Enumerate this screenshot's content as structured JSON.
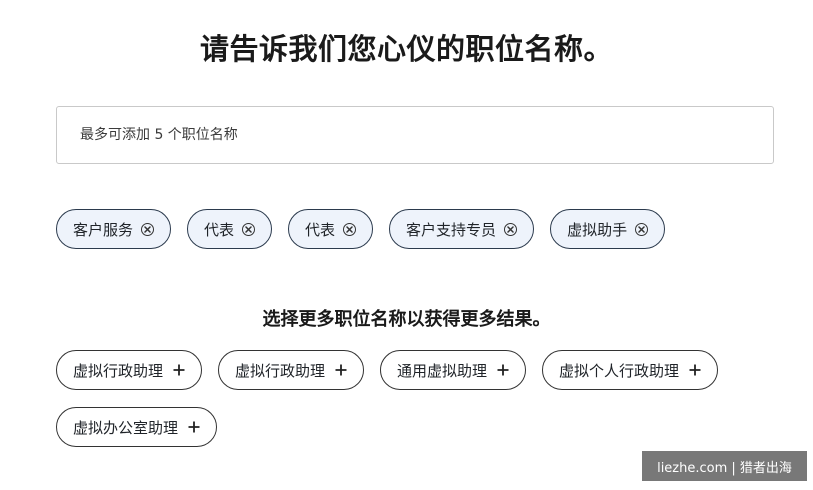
{
  "header": {
    "title": "请告诉我们您心仪的职位名称。"
  },
  "search": {
    "placeholder": "最多可添加 5 个职位名称"
  },
  "selected_titles": [
    {
      "label": "客户服务",
      "icon": "close-circle-icon"
    },
    {
      "label": "代表",
      "icon": "close-circle-icon"
    },
    {
      "label": "代表",
      "icon": "close-circle-icon"
    },
    {
      "label": "客户支持专员",
      "icon": "close-circle-icon"
    },
    {
      "label": "虚拟助手",
      "icon": "close-circle-icon"
    }
  ],
  "suggestions": {
    "heading": "选择更多职位名称以获得更多结果。",
    "items": [
      {
        "label": "虚拟行政助理",
        "icon": "plus-icon"
      },
      {
        "label": "虚拟行政助理",
        "icon": "plus-icon"
      },
      {
        "label": "通用虚拟助理",
        "icon": "plus-icon"
      },
      {
        "label": "虚拟个人行政助理",
        "icon": "plus-icon"
      },
      {
        "label": "虚拟办公室助理",
        "icon": "plus-icon"
      }
    ]
  },
  "watermark": {
    "text": "liezhe.com | 猎者出海"
  },
  "colors": {
    "selected_chip_bg": "#eef3fb",
    "chip_border": "#2b3a4d",
    "text": "#1f2328"
  }
}
